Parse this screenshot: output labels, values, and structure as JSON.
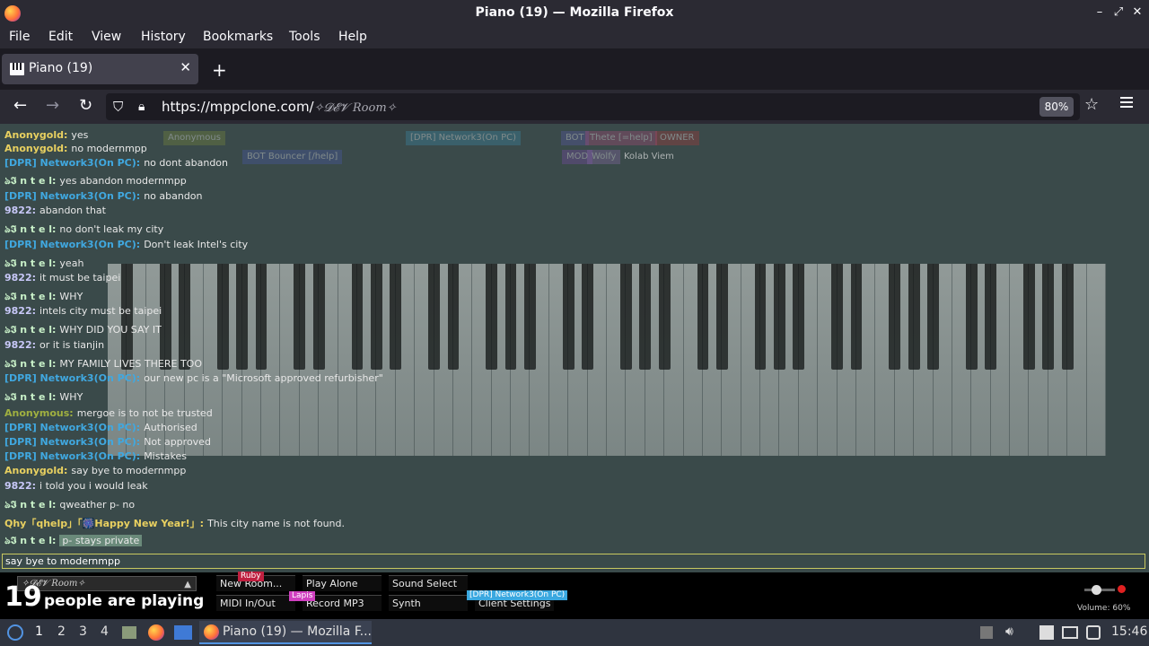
{
  "window": {
    "title": "Piano (19) — Mozilla Firefox"
  },
  "menu": [
    "File",
    "Edit",
    "View",
    "History",
    "Bookmarks",
    "Tools",
    "Help"
  ],
  "tab": {
    "label": "Piano (19)"
  },
  "nav": {
    "url_host": "https://mppclone.com/",
    "url_path": "✧𝓓𝓔𝓥 Room✧",
    "zoom": "80%"
  },
  "userlist": [
    {
      "name": "Anonymous",
      "color": "#7a8a3a"
    },
    {
      "name": "[DPR] Network3(On PC)",
      "color": "#3a8aaa"
    },
    {
      "name": "OWNER",
      "color": "#aa3a3a"
    },
    {
      "name": "BOT",
      "color": "#5a5aaa"
    },
    {
      "name": "Thete [=help]",
      "color": "#aa4a7a"
    },
    {
      "name": "MOD",
      "color": "#7a4aaa"
    },
    {
      "name": "Wolfy",
      "color": "#8a6aaa"
    },
    {
      "name": "Kolab Viem",
      "color": "#556666"
    },
    {
      "name": "BOT Bouncer [/help]",
      "color": "#4a5aaa"
    }
  ],
  "chat": [
    {
      "name": "Anonygold:",
      "color": "#e8d060",
      "text": "yes"
    },
    {
      "name": "Anonygold:",
      "color": "#e8d060",
      "text": "no modernmpp"
    },
    {
      "name": "[DPR] Network3(On PC):",
      "color": "#40a8e0",
      "text": "no dont abandon"
    },
    {
      "name": "ঌ𝕴 n t e l:",
      "color": "#c8f0c8",
      "text": "yes abandon modernmpp"
    },
    {
      "name": "[DPR] Network3(On PC):",
      "color": "#40a8e0",
      "text": "no abandon"
    },
    {
      "name": "9822:",
      "color": "#c8c8f8",
      "text": "abandon that"
    },
    {
      "name": "ঌ𝕴 n t e l:",
      "color": "#c8f0c8",
      "text": "no don't leak my city"
    },
    {
      "name": "[DPR] Network3(On PC):",
      "color": "#40a8e0",
      "text": "Don't leak Intel's city"
    },
    {
      "name": "ঌ𝕴 n t e l:",
      "color": "#c8f0c8",
      "text": "yeah"
    },
    {
      "name": "9822:",
      "color": "#c8c8f8",
      "text": "it must be taipei"
    },
    {
      "name": "ঌ𝕴 n t e l:",
      "color": "#c8f0c8",
      "text": "WHY"
    },
    {
      "name": "9822:",
      "color": "#c8c8f8",
      "text": "intels city must be taipei"
    },
    {
      "name": "ঌ𝕴 n t e l:",
      "color": "#c8f0c8",
      "text": "WHY DID YOU SAY IT"
    },
    {
      "name": "9822:",
      "color": "#c8c8f8",
      "text": "or it is tianjin"
    },
    {
      "name": "ঌ𝕴 n t e l:",
      "color": "#c8f0c8",
      "text": "MY FAMILY LIVES THERE TOO"
    },
    {
      "name": "[DPR] Network3(On PC):",
      "color": "#40a8e0",
      "text": "our new pc is a \"Microsoft approved refurbisher\""
    },
    {
      "name": "ঌ𝕴 n t e l:",
      "color": "#c8f0c8",
      "text": "WHY"
    },
    {
      "name": "Anonymous:",
      "color": "#a0b040",
      "text": "mergoe is to not be trusted"
    },
    {
      "name": "[DPR] Network3(On PC):",
      "color": "#40a8e0",
      "text": "Authorised"
    },
    {
      "name": "[DPR] Network3(On PC):",
      "color": "#40a8e0",
      "text": "Not approved"
    },
    {
      "name": "[DPR] Network3(On PC):",
      "color": "#40a8e0",
      "text": "Mistakes"
    },
    {
      "name": "Anonygold:",
      "color": "#e8d060",
      "text": "say bye to modernmpp"
    },
    {
      "name": "9822:",
      "color": "#c8c8f8",
      "text": "i told you i would leak"
    },
    {
      "name": "ঌ𝕴 n t e l:",
      "color": "#c8f0c8",
      "text": "qweather p- no"
    },
    {
      "name": "Qhy「qhelp」「🎆Happy New Year!」:",
      "color": "#e8d060",
      "text": "This city name is not found."
    },
    {
      "name": "ঌ𝕴 n t e l:",
      "color": "#c8f0c8",
      "text": "p- stays private"
    }
  ],
  "chat_input": {
    "value": "say bye to modernmpp"
  },
  "bottom": {
    "room": "✧𝓓𝓔𝓥 Room✧",
    "count": "19",
    "count_label": "people are playing",
    "buttons": [
      "New Room...",
      "Play Alone",
      "Sound Select",
      "MIDI In/Out",
      "Record MP3",
      "Synth",
      "Client Settings"
    ],
    "tag_ruby": "Ruby",
    "tag_lapis": "Lapis",
    "tag_dpr": "[DPR] Network3(On PC)",
    "volume": "Volume: 60%"
  },
  "taskbar": {
    "workspaces": [
      "1",
      "2",
      "3",
      "4"
    ],
    "window": "Piano (19) — Mozilla F...",
    "clock": "15:46"
  }
}
